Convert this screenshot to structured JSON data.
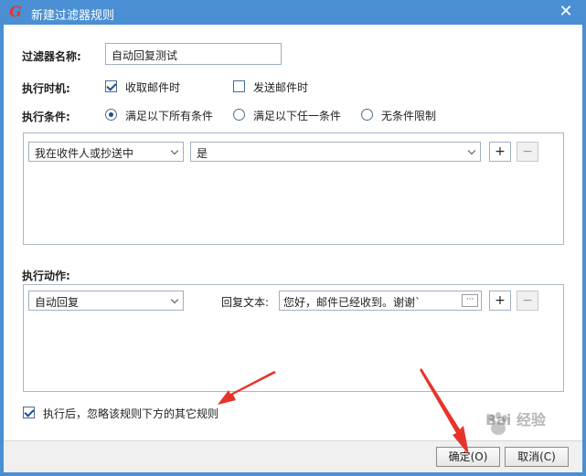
{
  "window": {
    "title": "新建过滤器规则",
    "close_glyph": "✕",
    "app_icon_glyph": "G"
  },
  "filter_name": {
    "label": "过滤器名称:",
    "value": "自动回复测试"
  },
  "exec_timing": {
    "label": "执行时机:",
    "options": [
      {
        "label": "收取邮件时",
        "checked": true
      },
      {
        "label": "发送邮件时",
        "checked": false
      }
    ]
  },
  "exec_condition": {
    "label": "执行条件:",
    "options": [
      {
        "label": "满足以下所有条件",
        "selected": true
      },
      {
        "label": "满足以下任一条件",
        "selected": false
      },
      {
        "label": "无条件限制",
        "selected": false
      }
    ]
  },
  "condition_row": {
    "field": "我在收件人或抄送中",
    "operator": "是",
    "add_glyph": "+",
    "remove_glyph": "−"
  },
  "actions": {
    "label": "执行动作:",
    "action": "自动回复",
    "reply_label": "回复文本:",
    "reply_value": "您好，邮件已经收到。谢谢`",
    "ellipsis_glyph": "···",
    "add_glyph": "+",
    "remove_glyph": "−"
  },
  "skip_rules": {
    "label": "执行后，忽略该规则下方的其它规则",
    "checked": true
  },
  "footer": {
    "ok_label": "确定(O)",
    "cancel_label": "取消(C)"
  },
  "watermark": {
    "text": "Bai 经验"
  },
  "colors": {
    "titlebar": "#4a8fd3",
    "arrow": "#e8332a",
    "check_mark": "#1e4e8c"
  }
}
